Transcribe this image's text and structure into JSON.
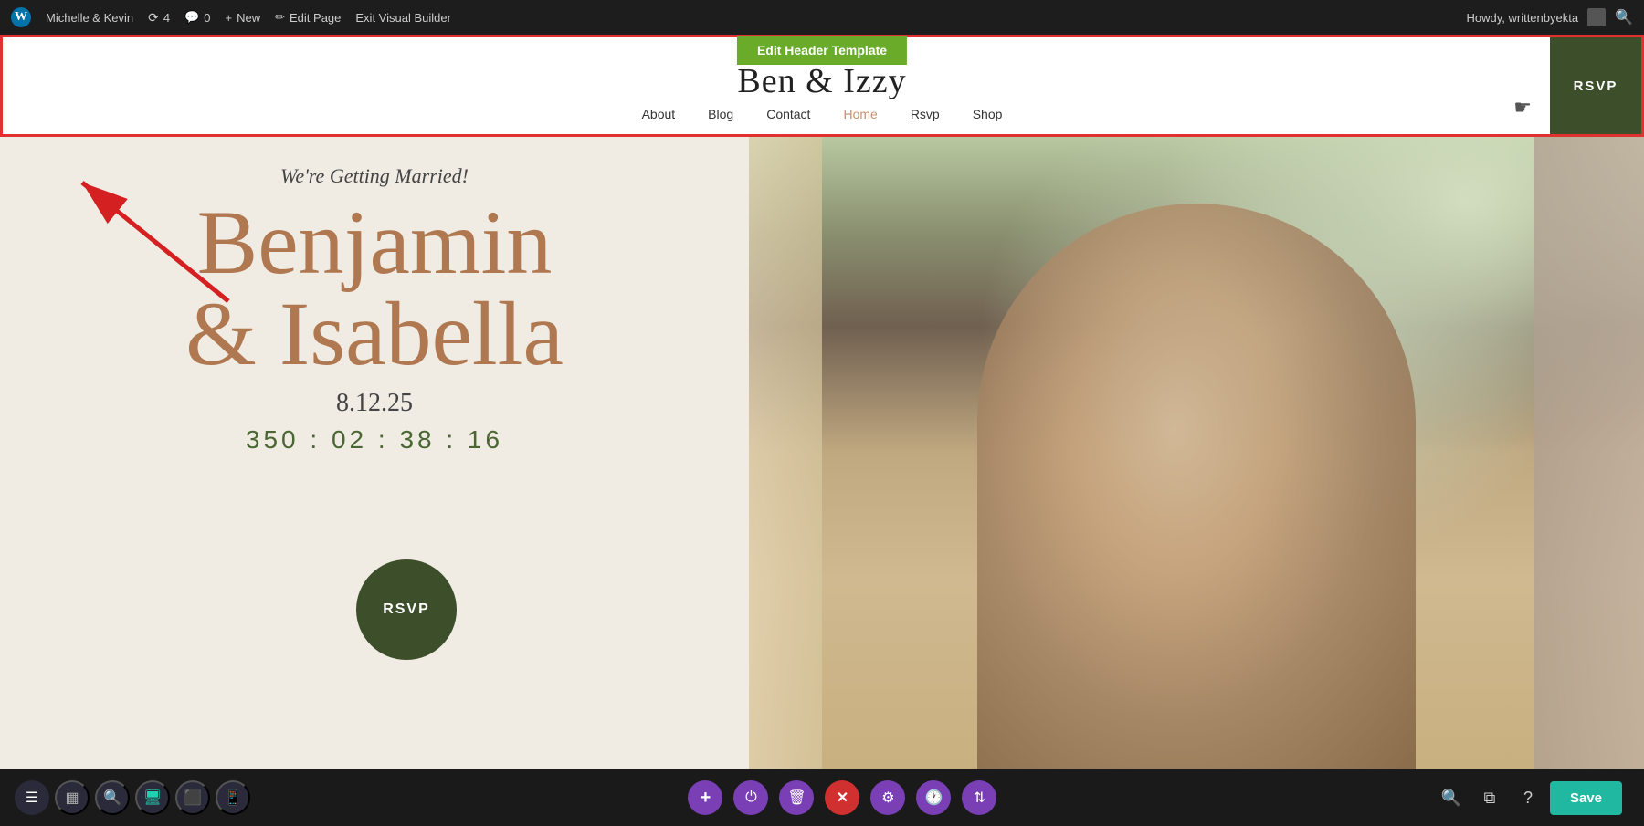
{
  "adminBar": {
    "wpIcon": "W",
    "siteName": "Michelle & Kevin",
    "syncCount": "4",
    "commentCount": "0",
    "newLabel": "New",
    "editPageLabel": "Edit Page",
    "exitBuilderLabel": "Exit Visual Builder",
    "howdy": "Howdy, writtenbyekta",
    "searchIcon": "🔍"
  },
  "header": {
    "editHeaderLabel": "Edit Header Template",
    "siteTitle": "Ben & Izzy",
    "navItems": [
      {
        "label": "About",
        "active": false
      },
      {
        "label": "Blog",
        "active": false
      },
      {
        "label": "Contact",
        "active": false
      },
      {
        "label": "Home",
        "active": true
      },
      {
        "label": "Rsvp",
        "active": false
      },
      {
        "label": "Shop",
        "active": false
      }
    ],
    "rsvpLabel": "RSVP"
  },
  "hero": {
    "gettingMarriedText": "We're Getting Married!",
    "bridegroomName1": "Benjamin",
    "bridegroomName2": "& Isabella",
    "date": "8.12.25",
    "countdown": "350 : 02 : 38 : 16",
    "rsvpCircleLabel": "RSVP"
  },
  "toolbar": {
    "menuIcon": "☰",
    "layoutIcon": "▦",
    "searchIcon": "🔍",
    "desktopIcon": "🖥",
    "tabletIcon": "📱",
    "mobileIcon": "📱",
    "addIcon": "+",
    "powerIcon": "⏻",
    "deleteIcon": "🗑",
    "closeIcon": "✕",
    "settingsIcon": "⚙",
    "historyIcon": "🕐",
    "adjustIcon": "⇅",
    "zoomIcon": "🔍",
    "layersIcon": "⧉",
    "helpIcon": "?",
    "saveLabel": "Save"
  },
  "colors": {
    "adminBg": "#1d1d1d",
    "headerBorder": "#e03030",
    "editHeaderBg": "#6aac2a",
    "rsvpHeaderBg": "#3d4f2a",
    "coupleNameColor": "#b07850",
    "activeNavColor": "#c8906a",
    "rsvpCircleBg": "#3d4f2a",
    "purpleBtn": "#7b3fb5",
    "redBtn": "#d03030",
    "tealBtn": "#20b8a0",
    "saveBtnBg": "#20b8a0"
  }
}
